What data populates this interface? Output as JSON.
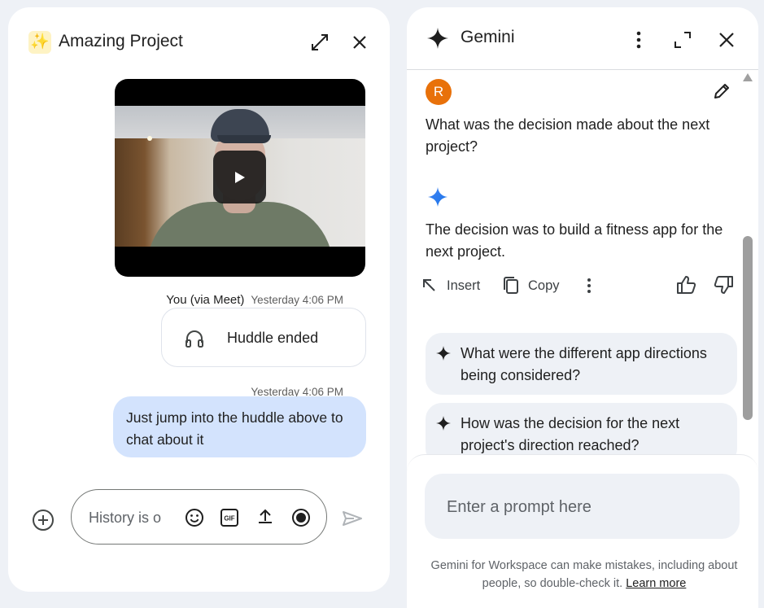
{
  "chat": {
    "emoji": "✨",
    "title": "Amazing Project",
    "icons": {
      "expand": "expand-icon",
      "close": "close-icon"
    },
    "video": {
      "play_icon": "play-icon"
    },
    "sender": "You (via Meet)",
    "sender_time": "Yesterday 4:06 PM",
    "huddle": {
      "icon": "headphones-icon",
      "label": "Huddle ended"
    },
    "message_time": "Yesterday 4:06 PM",
    "message": "Just jump into the huddle above to chat about it",
    "compose": {
      "placeholder": "History is o",
      "icons": [
        "add-icon",
        "emoji-icon",
        "gif-icon",
        "upload-icon",
        "record-icon",
        "send-icon"
      ]
    }
  },
  "gemini": {
    "title": "Gemini",
    "icons": {
      "more": "more-vert-icon",
      "expand": "expand-icon",
      "close": "close-icon"
    },
    "user_avatar": "R",
    "user_question": "What was the decision made about the next project?",
    "response": "The decision was to build a fitness app for the next project.",
    "actions": {
      "insert": "Insert",
      "copy": "Copy"
    },
    "suggestions": [
      "What were the different app directions being considered?",
      "How was the decision for the next project's direction reached?"
    ],
    "prompt_placeholder": "Enter a prompt here",
    "disclaimer": "Gemini for Workspace can make mistakes, including about people, so double-check it.",
    "learn_more": "Learn more"
  },
  "colors": {
    "background": "#eef1f6",
    "user_bubble": "#d3e3fd",
    "avatar": "#e8710a",
    "gemini_blue": "#1a73e8"
  }
}
